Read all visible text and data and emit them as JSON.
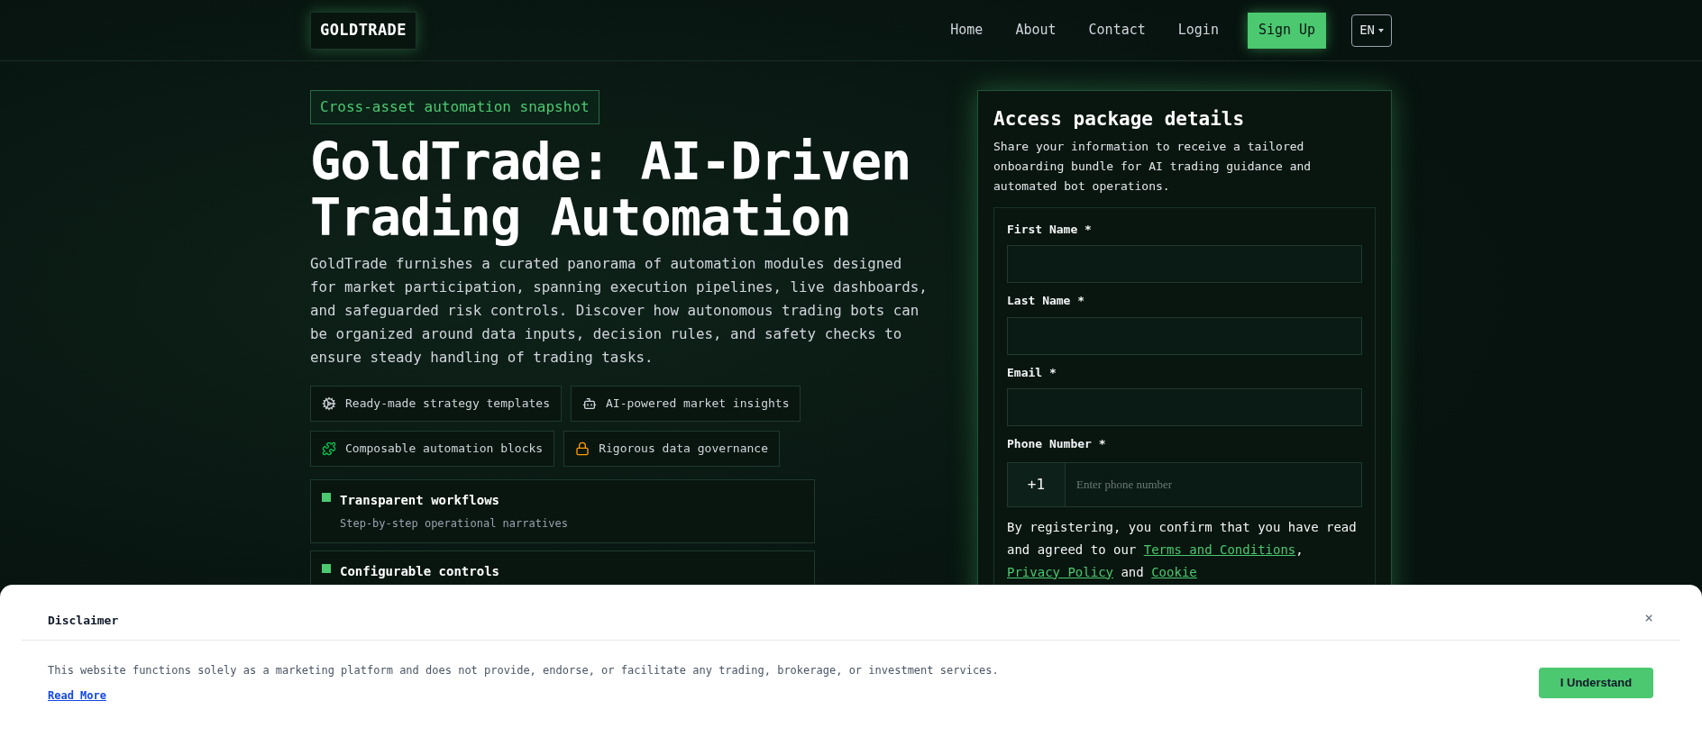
{
  "header": {
    "logo": "GOLDTRADE",
    "nav": [
      {
        "label": "Home",
        "kind": "link"
      },
      {
        "label": "About",
        "kind": "link"
      },
      {
        "label": "Contact",
        "kind": "link"
      },
      {
        "label": "Login",
        "kind": "link"
      },
      {
        "label": "Sign Up",
        "kind": "primary"
      },
      {
        "label": "EN",
        "kind": "language"
      }
    ]
  },
  "hero": {
    "badge": "Cross-asset automation snapshot",
    "title": "GoldTrade: AI-Driven Trading Automation",
    "description": "GoldTrade furnishes a curated panorama of automation modules designed for market participation, spanning execution pipelines, live dashboards, and safeguarded risk controls. Discover how autonomous trading bots can be organized around data inputs, decision rules, and safety checks to ensure steady handling of trading tasks.",
    "features": [
      {
        "label": "Ready-made strategy templates"
      },
      {
        "label": "AI-powered market insights"
      },
      {
        "label": "Composable automation blocks"
      },
      {
        "label": "Rigorous data governance"
      }
    ],
    "cards": [
      {
        "title": "Transparent workflows",
        "subtitle": "Step-by-step operational narratives"
      },
      {
        "title": "Configurable controls"
      }
    ]
  },
  "form": {
    "title": "Access package details",
    "description": "Share your information to receive a tailored onboarding bundle for AI trading guidance and automated bot operations.",
    "fields": [
      {
        "label": "First Name *",
        "kind": "text"
      },
      {
        "label": "Last Name *",
        "kind": "text"
      },
      {
        "label": "Email *",
        "kind": "text"
      },
      {
        "label": "Phone Number *",
        "kind": "phone",
        "prefix": "+1",
        "placeholder": "Enter phone number"
      }
    ],
    "consent": [
      {
        "kind": "text",
        "text": "By registering, you confirm that you have read and agreed to our "
      },
      {
        "kind": "link",
        "text": "Terms and Conditions"
      },
      {
        "kind": "text",
        "text": ", "
      },
      {
        "kind": "link",
        "text": "Privacy Policy"
      },
      {
        "kind": "text",
        "text": " and "
      },
      {
        "kind": "link",
        "text": "Cookie"
      }
    ]
  },
  "disclaimer": {
    "title": "Disclaimer",
    "close": "×",
    "text": "This website functions solely as a marketing platform and does not provide, endorse, or facilitate any trading, brokerage, or investment services.",
    "link": "Read More",
    "button": "I Understand"
  }
}
